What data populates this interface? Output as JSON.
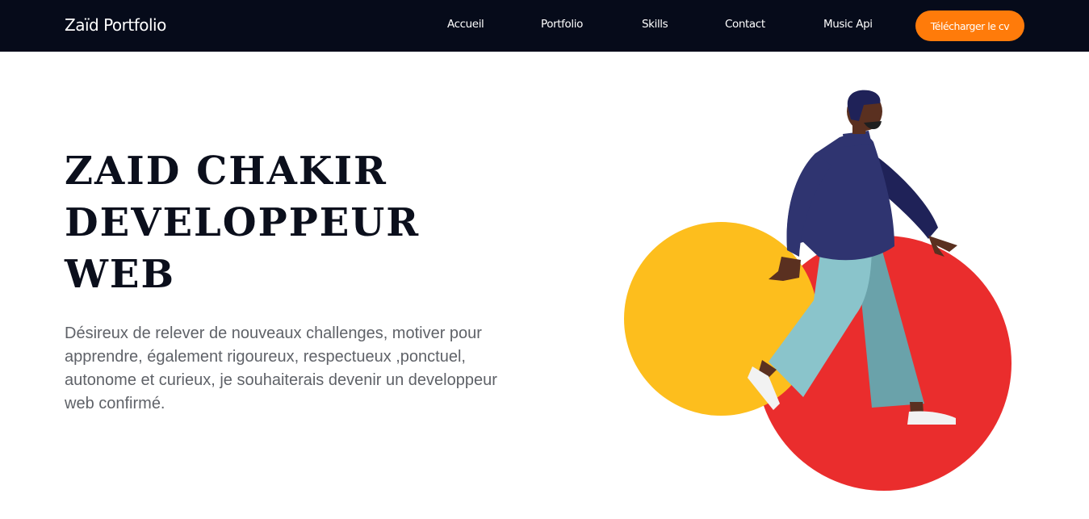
{
  "header": {
    "brand": "Zaïd Portfolio",
    "nav": [
      {
        "label": "Accueil"
      },
      {
        "label": "Portfolio"
      },
      {
        "label": "Skills"
      },
      {
        "label": "Contact"
      },
      {
        "label": "Music Api"
      }
    ],
    "cv_button": "Télécharger le cv"
  },
  "hero": {
    "title_lines": [
      "ZAID CHAKIR",
      "DEVELOPPEUR",
      "WEB"
    ],
    "description_lines": [
      "Désireux de relever de nouveaux challenges, motiver pour",
      "apprendre, également rigoureux, respectueux ,ponctuel,",
      "autonome et curieux, je souhaiterais devenir un developpeur",
      "web confirmé."
    ]
  },
  "illustration": {
    "figure": "walking-person",
    "shapes": [
      "yellow-circle",
      "red-circle"
    ]
  },
  "colors": {
    "navbar_bg": "#060b1a",
    "accent": "#ff7b0a",
    "title": "#0b0f1c",
    "text": "#5f6268",
    "yellow": "#fdbe1d",
    "red": "#ea2d2d",
    "sweater": "#2f3470",
    "pants": "#8ac4cb",
    "skin": "#5a3020"
  }
}
